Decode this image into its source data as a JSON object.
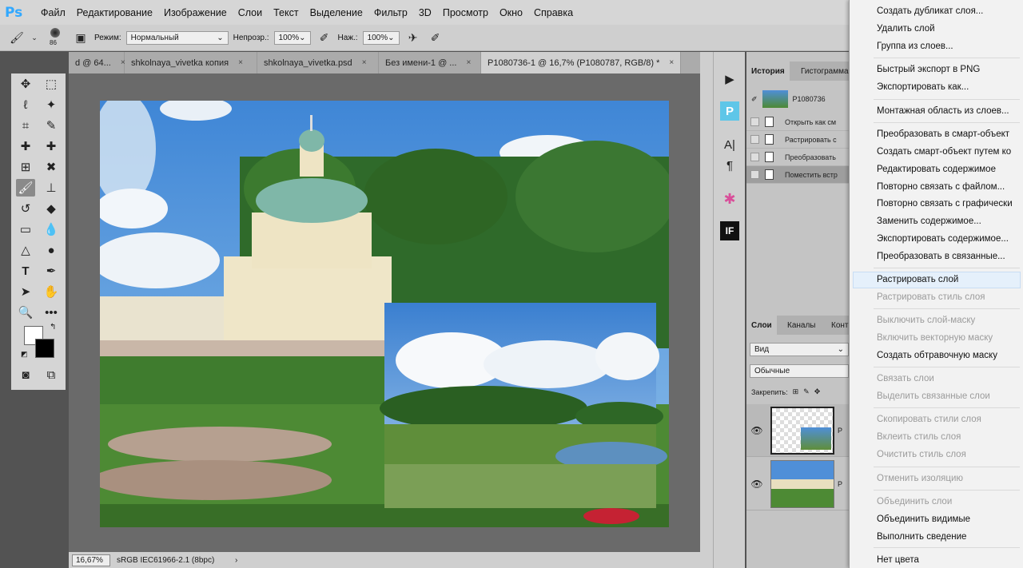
{
  "app": {
    "logo": "Ps"
  },
  "menubar": [
    "Файл",
    "Редактирование",
    "Изображение",
    "Слои",
    "Текст",
    "Выделение",
    "Фильтр",
    "3D",
    "Просмотр",
    "Окно",
    "Справка"
  ],
  "options": {
    "brush_size": "86",
    "mode_label": "Режим:",
    "mode_value": "Нормальный",
    "opacity_label": "Непрозр.:",
    "opacity_value": "100%",
    "pressure_label": "Наж.:",
    "pressure_value": "100%"
  },
  "tabs": [
    {
      "label": "d @ 64...",
      "close": "×"
    },
    {
      "label": "shkolnaya_vivetka копия",
      "close": "×"
    },
    {
      "label": "shkolnaya_vivetka.psd",
      "close": "×"
    },
    {
      "label": "Без имени-1 @ ...",
      "close": "×"
    },
    {
      "label": "P1080736-1 @ 16,7% (P1080787, RGB/8) *",
      "close": "×"
    }
  ],
  "tab_overflow": "»",
  "status": {
    "zoom": "16,67%",
    "profile": "sRGB IEC61966-2.1 (8bpc)",
    "arrow": "›"
  },
  "history": {
    "tabs": [
      "История",
      "Гистограмма"
    ],
    "snapshot": "P1080736",
    "rows": [
      "Открыть как см",
      "Растрировать с",
      "Преобразовать",
      "Поместить встр"
    ]
  },
  "layers": {
    "tabs": [
      "Слои",
      "Каналы",
      "Конт"
    ],
    "filter": "Вид",
    "blend": "Обычные",
    "lock_label": "Закрепить:",
    "rows": [
      {
        "name": "P"
      },
      {
        "name": "P"
      }
    ]
  },
  "context_menu": {
    "items": [
      {
        "label": "Создать дубликат слоя...",
        "enabled": true
      },
      {
        "label": "Удалить слой",
        "enabled": true
      },
      {
        "label": "Группа из слоев...",
        "enabled": true
      },
      {
        "label": "Быстрый экспорт в PNG",
        "enabled": true
      },
      {
        "label": "Экспортировать как...",
        "enabled": true
      },
      {
        "label": "Монтажная область из слоев...",
        "enabled": true
      },
      {
        "label": "Преобразовать в смарт-объект",
        "enabled": true
      },
      {
        "label": "Создать смарт-объект путем ко",
        "enabled": true
      },
      {
        "label": "Редактировать содержимое",
        "enabled": true
      },
      {
        "label": "Повторно связать с файлом...",
        "enabled": true
      },
      {
        "label": "Повторно связать с графически",
        "enabled": true
      },
      {
        "label": "Заменить содержимое...",
        "enabled": true
      },
      {
        "label": "Экспортировать содержимое...",
        "enabled": true
      },
      {
        "label": "Преобразовать в связанные...",
        "enabled": true
      },
      {
        "label": "Растрировать слой",
        "enabled": true
      },
      {
        "label": "Растрировать стиль слоя",
        "enabled": false
      },
      {
        "label": "Выключить слой-маску",
        "enabled": false
      },
      {
        "label": "Включить векторную маску",
        "enabled": false
      },
      {
        "label": "Создать обтравочную маску",
        "enabled": true
      },
      {
        "label": "Связать слои",
        "enabled": false
      },
      {
        "label": "Выделить связанные слои",
        "enabled": false
      },
      {
        "label": "Скопировать стили слоя",
        "enabled": false
      },
      {
        "label": "Вклеить стиль слоя",
        "enabled": false
      },
      {
        "label": "Очистить стиль слоя",
        "enabled": false
      },
      {
        "label": "Отменить изоляцию",
        "enabled": false
      },
      {
        "label": "Объединить слои",
        "enabled": false
      },
      {
        "label": "Объединить видимые",
        "enabled": true
      },
      {
        "label": "Выполнить сведение",
        "enabled": true
      },
      {
        "label": "Нет цвета",
        "enabled": true
      }
    ]
  },
  "colors": {
    "accent": "#31a8ff",
    "ui_bg": "#d6d6d6",
    "canvas_bg": "#6a6a6a"
  }
}
